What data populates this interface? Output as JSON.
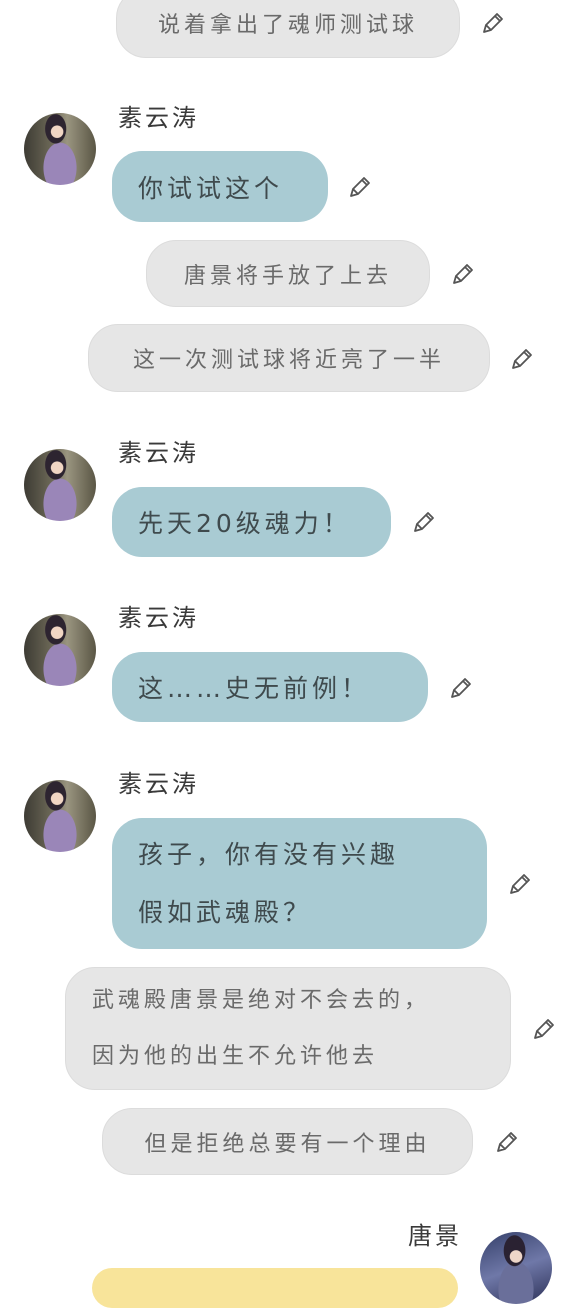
{
  "messages": [
    {
      "kind": "narration",
      "text": "说着拿出了魂师测试球"
    },
    {
      "kind": "character",
      "speaker": "素云涛",
      "avatar_icon": "character-avatar-icon",
      "text": "你试试这个"
    },
    {
      "kind": "narration",
      "text": "唐景将手放了上去"
    },
    {
      "kind": "narration",
      "text": "这一次测试球将近亮了一半"
    },
    {
      "kind": "character",
      "speaker": "素云涛",
      "avatar_icon": "character-avatar-icon",
      "text": "先天20级魂力！"
    },
    {
      "kind": "character",
      "speaker": "素云涛",
      "avatar_icon": "character-avatar-icon",
      "text": "这……史无前例！"
    },
    {
      "kind": "character",
      "speaker": "素云涛",
      "avatar_icon": "character-avatar-icon",
      "lines": [
        "孩子，你有没有兴趣",
        "假如武魂殿？"
      ]
    },
    {
      "kind": "narration",
      "lines": [
        "武魂殿唐景是绝对不会去的，",
        "因为他的出生不允许他去"
      ]
    },
    {
      "kind": "narration",
      "text": "但是拒绝总要有一个理由"
    },
    {
      "kind": "player",
      "speaker": "唐景",
      "avatar_icon": "player-avatar-icon",
      "text": ""
    }
  ],
  "icons": {
    "edit": "pencil-icon"
  },
  "colors": {
    "narration_bubble": "#e6e6e6",
    "character_bubble": "#a9cbd3",
    "player_bubble": "#f8e49a",
    "background": "#ffffff"
  }
}
